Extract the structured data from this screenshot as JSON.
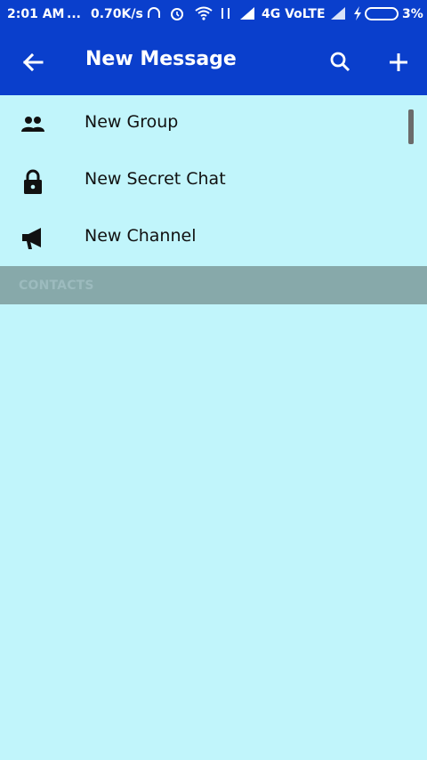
{
  "status_bar": {
    "time": "2:01 AM",
    "more": "...",
    "speed": "0.70K/s",
    "network": "4G VoLTE",
    "battery": "3%",
    "icons": [
      "headphones-icon",
      "alarm-icon",
      "wifi-icon",
      "data-arrows-icon",
      "signal-icon",
      "signal-icon-2",
      "charging-icon",
      "battery-icon"
    ]
  },
  "appbar": {
    "title": "New Message",
    "back_icon": "arrow-left-icon",
    "search_icon": "search-icon",
    "add_icon": "plus-icon"
  },
  "menu": {
    "items": [
      {
        "label": "New Group",
        "icon": "group-icon"
      },
      {
        "label": "New Secret Chat",
        "icon": "lock-icon"
      },
      {
        "label": "New Channel",
        "icon": "megaphone-icon"
      }
    ]
  },
  "contacts_header": "CONTACTS",
  "colors": {
    "appbar": "#0a3fcc",
    "background": "#c1f5fb",
    "section_header": "#87a9aa"
  }
}
